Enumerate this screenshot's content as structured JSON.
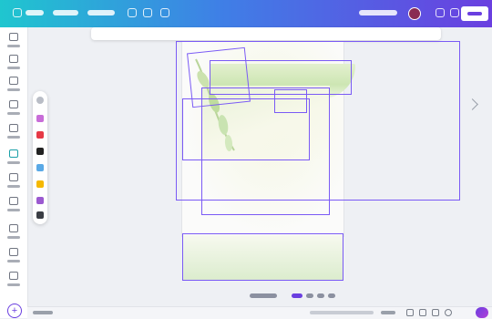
{
  "colors": {
    "topbar_start": "#1fc6cf",
    "topbar_end": "#6a3fe0",
    "selection": "#7a5af5",
    "accent": "#6a3fe0"
  },
  "topbar": {
    "icons": [
      "menu-icon",
      "file-icon",
      "resize-icon",
      "edit-icon",
      "undo-icon",
      "redo-icon",
      "sync-icon",
      "avatar-icon",
      "analytics-icon",
      "comment-icon",
      "share-button"
    ]
  },
  "left_rail": {
    "items": [
      "design-tab",
      "elements-tab",
      "text-tab",
      "brand-tab",
      "uploads-tab",
      "draw-tab",
      "projects-tab",
      "apps-tab",
      "more-tab",
      "photos-tab",
      "magic-tab"
    ]
  },
  "palette": {
    "tools": [
      "select-tool",
      "pen-tool",
      "marker-tool",
      "highlighter-tool",
      "eraser-tool",
      "sticky-note-tool",
      "text-tool",
      "shape-tool"
    ]
  },
  "toolbar": {
    "icons": [
      "font-icon",
      "color-icon",
      "bold-icon",
      "italic-icon",
      "underline-icon",
      "strikethrough-icon",
      "list-icon",
      "align-icon",
      "spacing-icon",
      "effects-icon",
      "animate-icon",
      "more-icon"
    ]
  },
  "bottom_controls": {
    "icons": [
      "notes-icon",
      "page-icon",
      "grid-icon",
      "fullscreen-icon",
      "help-icon"
    ]
  }
}
